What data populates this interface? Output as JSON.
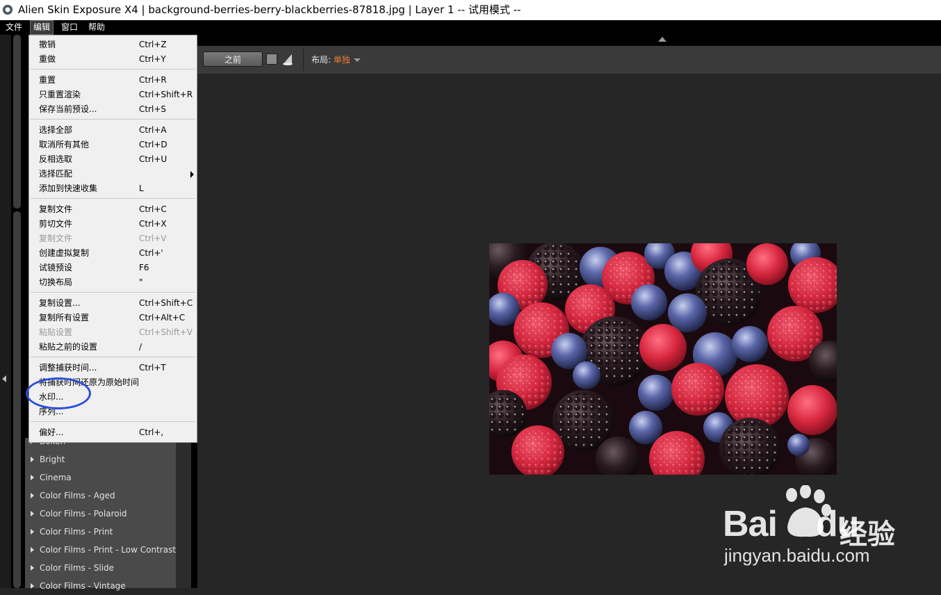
{
  "window": {
    "title": "Alien Skin Exposure X4 | background-berries-berry-blackberries-87818.jpg | Layer 1 -- 试用模式 --"
  },
  "menubar": {
    "items": [
      {
        "label": "文件"
      },
      {
        "label": "编辑",
        "active": true
      },
      {
        "label": "窗口"
      },
      {
        "label": "帮助"
      }
    ]
  },
  "toolbar": {
    "before_label": "之前",
    "layout_label": "布局:",
    "layout_value": "单独"
  },
  "edit_menu": {
    "items": [
      {
        "label": "撤销",
        "shortcut": "Ctrl+Z"
      },
      {
        "label": "重做",
        "shortcut": "Ctrl+Y"
      },
      {
        "label": "重置",
        "shortcut": "Ctrl+R"
      },
      {
        "label": "只重置渲染",
        "shortcut": "Ctrl+Shift+R"
      },
      {
        "label": "保存当前预设...",
        "shortcut": "Ctrl+S"
      },
      {
        "label": "选择全部",
        "shortcut": "Ctrl+A"
      },
      {
        "label": "取消所有其他",
        "shortcut": "Ctrl+D"
      },
      {
        "label": "反相选取",
        "shortcut": "Ctrl+U"
      },
      {
        "label": "选择匹配",
        "shortcut": "",
        "submenu": true
      },
      {
        "label": "添加到快速收集",
        "shortcut": "L"
      },
      {
        "label": "复制文件",
        "shortcut": "Ctrl+C"
      },
      {
        "label": "剪切文件",
        "shortcut": "Ctrl+X"
      },
      {
        "label": "复制文件",
        "shortcut": "Ctrl+V",
        "disabled": true
      },
      {
        "label": "创建虚拟复制",
        "shortcut": "Ctrl+'"
      },
      {
        "label": "试镜预设",
        "shortcut": "F6"
      },
      {
        "label": "切换布局",
        "shortcut": "\""
      },
      {
        "label": "复制设置...",
        "shortcut": "Ctrl+Shift+C"
      },
      {
        "label": "复制所有设置",
        "shortcut": "Ctrl+Alt+C"
      },
      {
        "label": "粘贴设置",
        "shortcut": "Ctrl+Shift+V",
        "disabled": true
      },
      {
        "label": "粘贴之前的设置",
        "shortcut": "/"
      },
      {
        "label": "调整捕获时间...",
        "shortcut": "Ctrl+T"
      },
      {
        "label": "将捕获时间还原为原始时间",
        "shortcut": ""
      },
      {
        "label": "水印...",
        "shortcut": ""
      },
      {
        "label": "序列...",
        "shortcut": ""
      },
      {
        "label": "偏好...",
        "shortcut": "Ctrl+,"
      }
    ]
  },
  "presets": {
    "items": [
      {
        "label": "Bokeh"
      },
      {
        "label": "Bright"
      },
      {
        "label": "Cinema"
      },
      {
        "label": "Color Films - Aged"
      },
      {
        "label": "Color Films - Polaroid"
      },
      {
        "label": "Color Films - Print"
      },
      {
        "label": "Color Films - Print - Low Contrast"
      },
      {
        "label": "Color Films - Slide"
      },
      {
        "label": "Color Films - Vintage"
      }
    ]
  },
  "watermark": {
    "brand": "Bai",
    "brand_du": "du",
    "jingyan": "经验",
    "url": "jingyan.baidu.com"
  },
  "colors": {
    "accent": "#f07a30",
    "highlight_circle": "#2c4fd8"
  }
}
